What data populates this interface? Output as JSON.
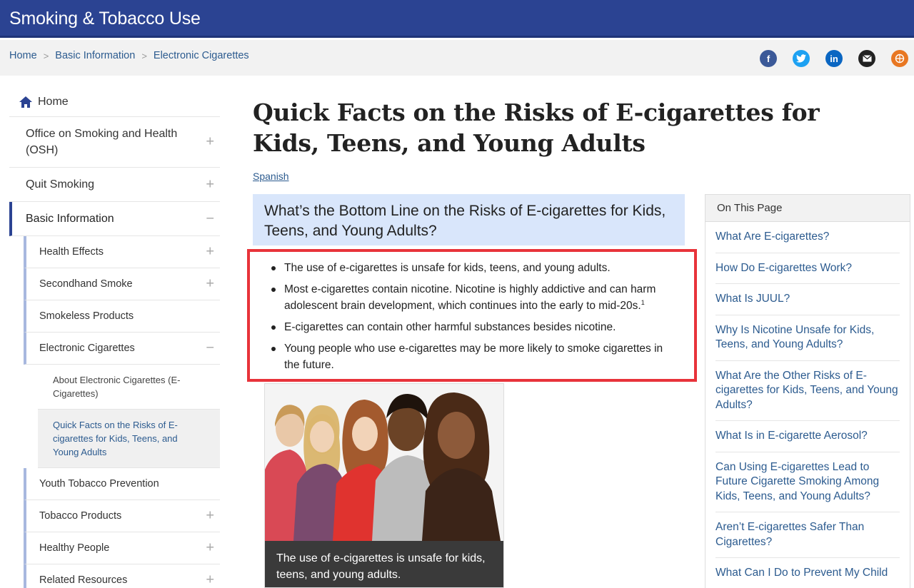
{
  "header": {
    "site_title": "Smoking & Tobacco Use"
  },
  "breadcrumb": {
    "items": [
      "Home",
      "Basic Information",
      "Electronic Cigarettes"
    ],
    "separator": ">"
  },
  "social": [
    "facebook-icon",
    "twitter-icon",
    "linkedin-icon",
    "email-icon",
    "syndicate-icon"
  ],
  "sidenav": {
    "home": "Home",
    "items": [
      {
        "label": "Office on Smoking and Health (OSH)",
        "toggle": "+"
      },
      {
        "label": "Quit Smoking",
        "toggle": "+"
      },
      {
        "label": "Basic Information",
        "toggle": "−"
      },
      {
        "label": "Health Effects",
        "toggle": "+"
      },
      {
        "label": "Secondhand Smoke",
        "toggle": "+"
      },
      {
        "label": "Smokeless Products",
        "toggle": ""
      },
      {
        "label": "Electronic Cigarettes",
        "toggle": "−"
      },
      {
        "label": "About Electronic Cigarettes (E-Cigarettes)",
        "toggle": ""
      },
      {
        "label": "Quick Facts on the Risks of E-cigarettes for Kids, Teens, and Young Adults",
        "toggle": ""
      },
      {
        "label": "Youth Tobacco Prevention",
        "toggle": ""
      },
      {
        "label": "Tobacco Products",
        "toggle": "+"
      },
      {
        "label": "Healthy People",
        "toggle": "+"
      },
      {
        "label": "Related Resources",
        "toggle": "+"
      }
    ]
  },
  "main": {
    "title": "Quick Facts on the Risks of E-cigarettes for Kids, Teens, and Young Adults",
    "language_link": "Spanish",
    "callout_heading": "What’s the Bottom Line on the Risks of E-cigarettes for Kids, Teens, and Young Adults?",
    "key_points": [
      "The use of e-cigarettes is unsafe for kids, teens, and young adults.",
      "Most e-cigarettes contain nicotine. Nicotine is highly addictive and can harm adolescent brain development, which continues into the early to mid-20s.",
      "E-cigarettes can contain other harmful substances besides nicotine.",
      "Young people who use e-cigarettes may be more likely to smoke cigarettes in the future."
    ],
    "footnote_ref": "1",
    "image_caption": "The use of e-cigarettes is unsafe for kids, teens, and young adults."
  },
  "on_this_page": {
    "heading": "On This Page",
    "links": [
      "What Are E-cigarettes?",
      "How Do E-cigarettes Work?",
      "What Is JUUL?",
      "Why Is Nicotine Unsafe for Kids, Teens, and Young Adults?",
      "What Are the Other Risks of E-cigarettes for Kids, Teens, and Young Adults?",
      "What Is in E-cigarette Aerosol?",
      "Can Using E-cigarettes Lead to Future Cigarette Smoking Among Kids, Teens, and Young Adults?",
      "Aren’t E-cigarettes Safer Than Cigarettes?",
      "What Can I Do to Prevent My Child"
    ]
  },
  "colors": {
    "header_bg": "#2b4392",
    "link": "#2c5b8f",
    "callout_bg": "#d9e6fb",
    "highlight_border": "#e8333a"
  }
}
